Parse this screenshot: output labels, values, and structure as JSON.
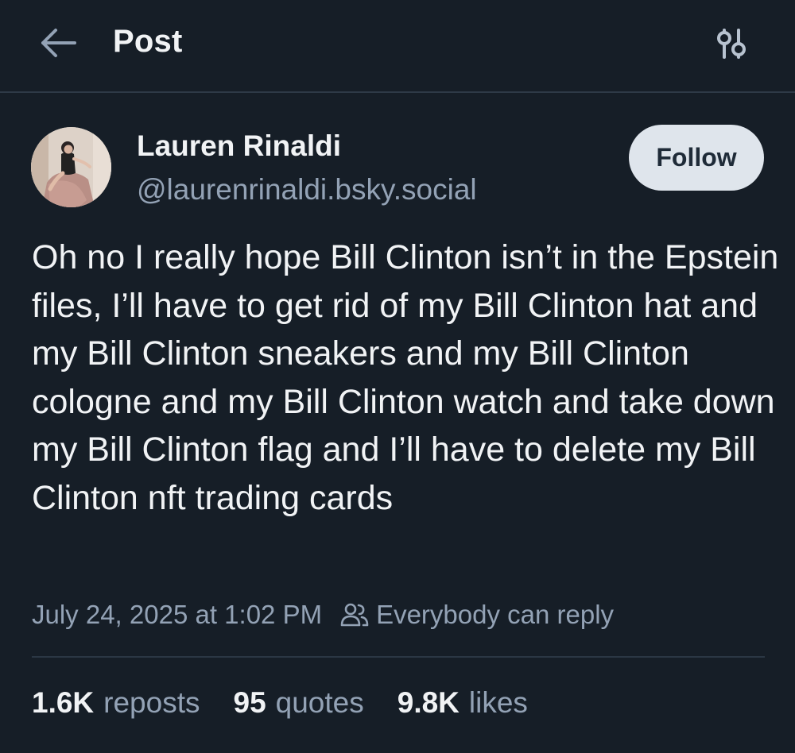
{
  "header": {
    "back_icon": "arrow-left-icon",
    "title": "Post",
    "options_icon": "sliders-icon"
  },
  "author": {
    "name": "Lauren Rinaldi",
    "handle": "@laurenrinaldi.bsky.social",
    "follow_label": "Follow"
  },
  "post": {
    "text": "Oh no I really hope Bill Clinton isn’t in the Epstein files, I’ll have to get rid of my Bill Clinton hat and my Bill Clinton sneakers and my Bill Clinton cologne and my Bill Clinton watch and take down my Bill Clinton flag and I’ll have to delete my Bill Clinton nft trading cards",
    "timestamp": "July 24, 2025 at 1:02 PM",
    "reply_icon": "people-icon",
    "reply_setting": "Everybody can reply"
  },
  "stats": {
    "reposts_count": "1.6K",
    "reposts_label": "reposts",
    "quotes_count": "95",
    "quotes_label": "quotes",
    "likes_count": "9.8K",
    "likes_label": "likes"
  },
  "colors": {
    "background": "#161e27",
    "text_primary": "#f1f3f5",
    "text_secondary": "#93a2b5",
    "follow_bg": "#dfe5ec"
  }
}
